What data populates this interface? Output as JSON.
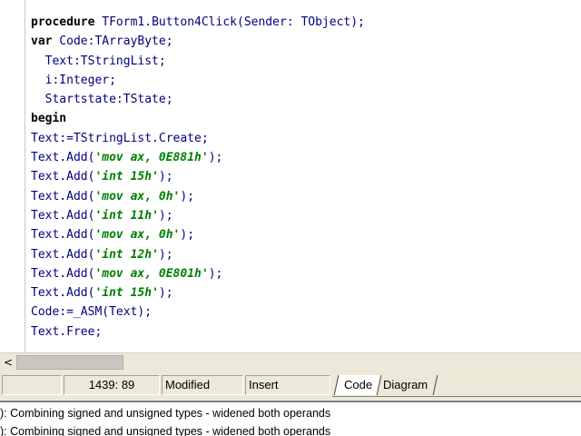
{
  "editor": {
    "lines": [
      [
        {
          "t": "procedure",
          "c": "kw"
        },
        {
          "t": " TForm1.Button4Click",
          "c": "sym"
        },
        {
          "t": "(",
          "c": "sym"
        },
        {
          "t": "Sender: TObject",
          "c": "sym"
        },
        {
          "t": ");",
          "c": "sym"
        }
      ],
      [
        {
          "t": "var",
          "c": "kw"
        },
        {
          "t": " Code:TArrayByte;",
          "c": "sym"
        }
      ],
      [
        {
          "t": "  Text:TStringList;",
          "c": "sym"
        }
      ],
      [
        {
          "t": "  i:Integer;",
          "c": "sym"
        }
      ],
      [
        {
          "t": "  Startstate:TState;",
          "c": "sym"
        }
      ],
      [
        {
          "t": "begin",
          "c": "kw"
        }
      ],
      [
        {
          "t": "Text:=TStringList.Create;",
          "c": "sym"
        }
      ],
      [
        {
          "t": "Text.Add(",
          "c": "sym"
        },
        {
          "t": "'mov ax, 0E881h'",
          "c": "str"
        },
        {
          "t": ");",
          "c": "sym"
        }
      ],
      [
        {
          "t": "Text.Add(",
          "c": "sym"
        },
        {
          "t": "'int 15h'",
          "c": "str"
        },
        {
          "t": ");",
          "c": "sym"
        }
      ],
      [
        {
          "t": "Text.Add(",
          "c": "sym"
        },
        {
          "t": "'mov ax, 0h'",
          "c": "str"
        },
        {
          "t": ");",
          "c": "sym"
        }
      ],
      [
        {
          "t": "Text.Add(",
          "c": "sym"
        },
        {
          "t": "'int 11h'",
          "c": "str"
        },
        {
          "t": ");",
          "c": "sym"
        }
      ],
      [
        {
          "t": "Text.Add(",
          "c": "sym"
        },
        {
          "t": "'mov ax, 0h'",
          "c": "str"
        },
        {
          "t": ");",
          "c": "sym"
        }
      ],
      [
        {
          "t": "Text.Add(",
          "c": "sym"
        },
        {
          "t": "'int 12h'",
          "c": "str"
        },
        {
          "t": ");",
          "c": "sym"
        }
      ],
      [
        {
          "t": "Text.Add(",
          "c": "sym"
        },
        {
          "t": "'mov ax, 0E801h'",
          "c": "str"
        },
        {
          "t": ");",
          "c": "sym"
        }
      ],
      [
        {
          "t": "Text.Add(",
          "c": "sym"
        },
        {
          "t": "'int 15h'",
          "c": "str"
        },
        {
          "t": ");",
          "c": "sym"
        }
      ],
      [
        {
          "t": "Code:=_ASM",
          "c": "sym"
        },
        {
          "t": "(",
          "c": "sym"
        },
        {
          "t": "Text",
          "c": "sym"
        },
        {
          "t": ");",
          "c": "sym"
        }
      ],
      [
        {
          "t": "Text.Free;",
          "c": "sym"
        }
      ]
    ]
  },
  "scrollbar": {
    "left_arrow": "<"
  },
  "statusbar": {
    "position": "1439:  89",
    "modified": "Modified",
    "insert_mode": "Insert"
  },
  "tabs": {
    "code": "Code",
    "diagram": "Diagram"
  },
  "messages": [
    "): Combining signed and unsigned types - widened both operands",
    "): Combining signed and unsigned types - widened both operands"
  ]
}
